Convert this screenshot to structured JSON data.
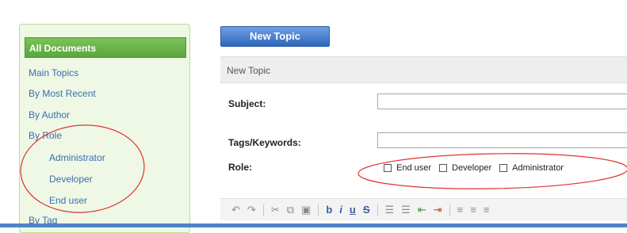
{
  "sidebar": {
    "header": "All Documents",
    "items": [
      {
        "label": "Main Topics"
      },
      {
        "label": "By Most Recent"
      },
      {
        "label": "By Author"
      },
      {
        "label": "By Role"
      },
      {
        "label": "Administrator"
      },
      {
        "label": "Developer"
      },
      {
        "label": "End user"
      },
      {
        "label": "By Tag"
      }
    ]
  },
  "main": {
    "new_topic_button": "New Topic",
    "form_title": "New Topic",
    "subject_label": "Subject:",
    "subject_value": "",
    "tags_label": "Tags/Keywords:",
    "tags_value": "",
    "role_label": "Role:",
    "role_options": [
      {
        "label": "End user",
        "checked": false
      },
      {
        "label": "Developer",
        "checked": false
      },
      {
        "label": "Administrator",
        "checked": false
      }
    ]
  },
  "toolbar": {
    "icons": [
      "undo-icon",
      "redo-icon",
      "cut-icon",
      "copy-icon",
      "paste-icon",
      "bold-icon",
      "italic-icon",
      "underline-icon",
      "strikethrough-icon",
      "numbered-list-icon",
      "bulleted-list-icon",
      "outdent-icon",
      "indent-icon",
      "align-left-icon",
      "align-center-icon",
      "align-right-icon"
    ]
  },
  "colors": {
    "sidebar_header": "#5aa73c",
    "button_blue": "#2f66bd",
    "annotation_red": "#e0332e",
    "link_blue": "#3b6db3"
  }
}
